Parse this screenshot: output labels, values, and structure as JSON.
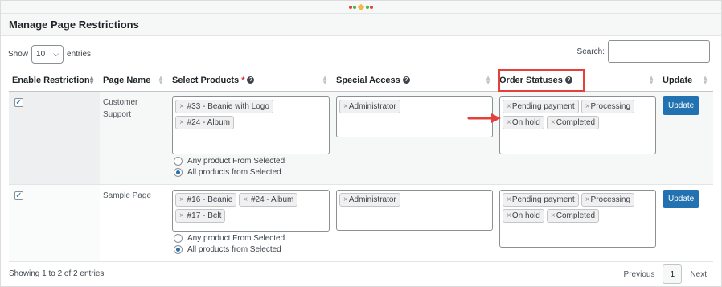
{
  "panel": {
    "title": "Manage Page Restrictions"
  },
  "controls": {
    "show_label": "Show",
    "entries_value": "10",
    "entries_label": "entries",
    "search_label": "Search:",
    "search_value": ""
  },
  "table": {
    "headers": {
      "enable": "Enable Restriction",
      "page": "Page Name",
      "products": "Select Products",
      "products_required": "*",
      "access": "Special Access",
      "statuses": "Order Statuses",
      "update": "Update"
    },
    "rows": [
      {
        "checked": true,
        "page_name": "Customer Support",
        "products": [
          "#33 - Beanie with Logo",
          "#24 - Album"
        ],
        "access": [
          "Administrator"
        ],
        "statuses": [
          "Pending payment",
          "Processing",
          "On hold",
          "Completed"
        ],
        "radio_any": "Any product From Selected",
        "radio_all": "All products from Selected",
        "selected_radio": "all",
        "update_label": "Update"
      },
      {
        "checked": true,
        "page_name": "Sample Page",
        "products": [
          "#16 - Beanie",
          "#24 - Album",
          "#17 - Belt"
        ],
        "access": [
          "Administrator"
        ],
        "statuses": [
          "Pending payment",
          "Processing",
          "On hold",
          "Completed"
        ],
        "radio_any": "Any product From Selected",
        "radio_all": "All products from Selected",
        "selected_radio": "all",
        "update_label": "Update"
      }
    ]
  },
  "footer": {
    "info": "Showing 1 to 2 of 2 entries",
    "previous": "Previous",
    "current_page": "1",
    "next": "Next"
  },
  "colors": {
    "accent": "#2271b1",
    "highlight": "#e5403b"
  },
  "icons": {
    "remove": "×",
    "checkmark": "✓",
    "help": "?"
  }
}
